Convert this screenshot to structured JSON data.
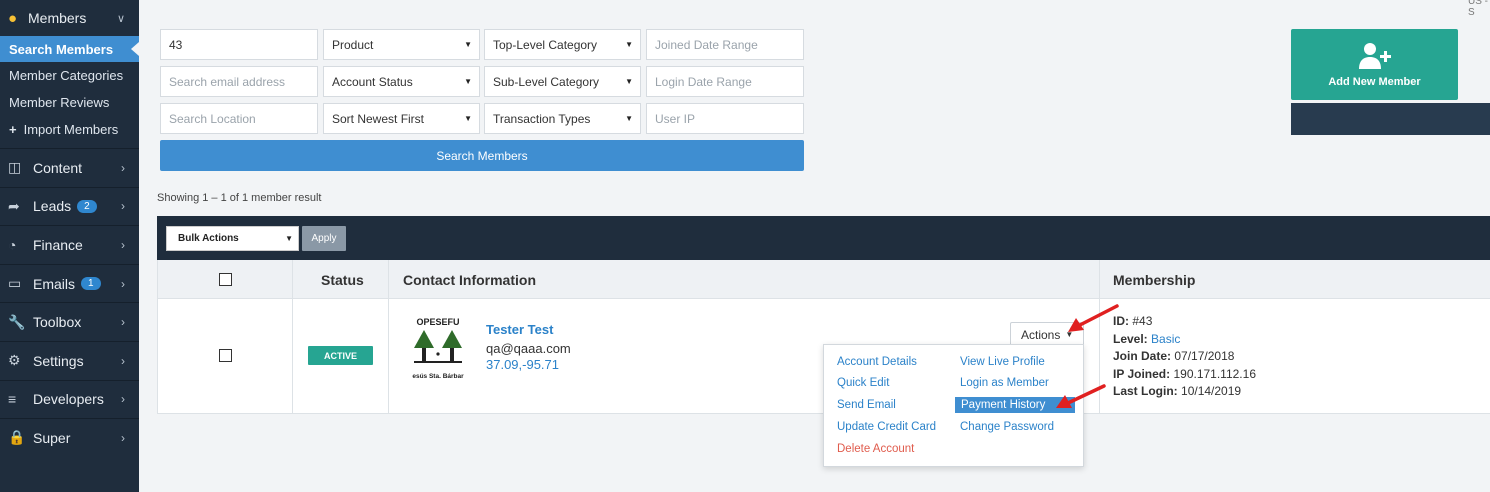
{
  "sidebar": {
    "members_label": "Members",
    "active_label": "Search Members",
    "sub_items": [
      "Member Categories",
      "Member Reviews",
      "Import Members"
    ],
    "items": [
      {
        "label": "Content",
        "icon": "folder-icon",
        "badge": ""
      },
      {
        "label": "Leads",
        "icon": "share-icon",
        "badge": "2"
      },
      {
        "label": "Finance",
        "icon": "pie-chart-icon",
        "badge": ""
      },
      {
        "label": "Emails",
        "icon": "inbox-icon",
        "badge": "1"
      },
      {
        "label": "Toolbox",
        "icon": "wrench-icon",
        "badge": ""
      },
      {
        "label": "Settings",
        "icon": "gear-icon",
        "badge": ""
      },
      {
        "label": "Developers",
        "icon": "sliders-icon",
        "badge": ""
      },
      {
        "label": "Super",
        "icon": "lock-icon",
        "badge": ""
      }
    ]
  },
  "filters": {
    "keyword_value": "43",
    "product": "Product",
    "top_category": "Top-Level Category",
    "joined_range_ph": "Joined Date Range",
    "email_ph": "Search email address",
    "account_status": "Account Status",
    "sub_category": "Sub-Level Category",
    "login_range_ph": "Login Date Range",
    "location_ph": "Search Location",
    "sort": "Sort Newest First",
    "transaction_types": "Transaction Types",
    "user_ip_ph": "User IP",
    "search_button": "Search Members"
  },
  "add_member_label": "Add New Member",
  "region_label": "US - S",
  "results_text": "Showing 1 – 1 of 1 member result",
  "bulk": {
    "select_label": "Bulk Actions",
    "apply_label": "Apply"
  },
  "table": {
    "headers": {
      "status": "Status",
      "contact": "Contact Information",
      "membership": "Membership"
    },
    "row": {
      "status": "ACTIVE",
      "logo_text_top": "OPESEFU",
      "logo_text_bottom": "esús Sta. Bárbar",
      "name": "Tester Test",
      "email": "qa@qaaa.com",
      "location": "37.09,-95.71",
      "actions_label": "Actions",
      "membership": {
        "id_label": "ID:",
        "id_value": "#43",
        "level_label": "Level:",
        "level_value": "Basic",
        "join_label": "Join Date:",
        "join_value": "07/17/2018",
        "ip_label": "IP Joined:",
        "ip_value": "190.171.112.16",
        "last_label": "Last Login:",
        "last_value": "10/14/2019"
      }
    }
  },
  "actions_menu": {
    "account_details": "Account Details",
    "view_live_profile": "View Live Profile",
    "quick_edit": "Quick Edit",
    "login_as_member": "Login as Member",
    "send_email": "Send Email",
    "payment_history": "Payment History",
    "update_credit_card": "Update Credit Card",
    "change_password": "Change Password",
    "delete_account": "Delete Account"
  },
  "colors": {
    "sidebar": "#1f2d3d",
    "accent": "#3f8ed1",
    "teal": "#26a592",
    "annotation_arrow": "#e02020"
  }
}
